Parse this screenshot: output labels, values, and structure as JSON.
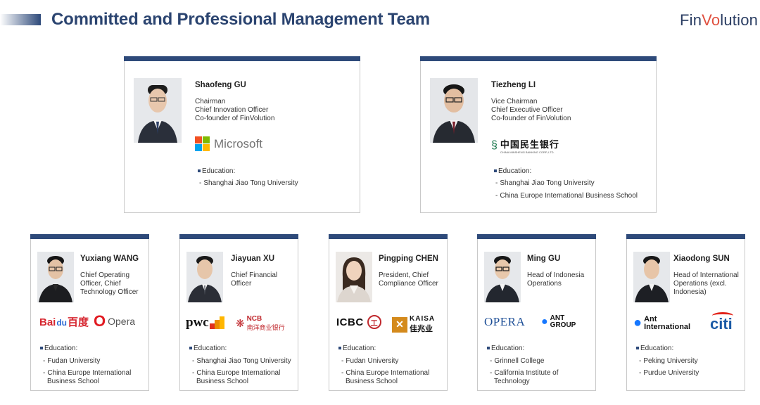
{
  "page": {
    "title": "Committed and Professional Management Team",
    "brand_pre": "Fin",
    "brand_accent": "Vo",
    "brand_post": "lution"
  },
  "colors": {
    "header_blue": "#2e4a7a",
    "title_blue": "#2b4470",
    "brand_red": "#e0503f"
  },
  "edu_label": "Education:",
  "dash": "-",
  "members": [
    {
      "name": "Shaofeng GU",
      "roles": [
        "Chairman",
        "Chief Innovation Officer",
        "Co-founder of FinVolution"
      ],
      "logos": [
        "Microsoft"
      ],
      "education": [
        "Shanghai Jiao Tong University"
      ]
    },
    {
      "name": "Tiezheng LI",
      "roles": [
        "Vice Chairman",
        "Chief Executive Officer",
        "Co-founder of FinVolution"
      ],
      "logos": [
        "中国民生银行",
        "CHINA MINSHENG BANKING CORP.,LTD."
      ],
      "education": [
        "Shanghai Jiao Tong University",
        "China Europe International Business School"
      ]
    },
    {
      "name": "Yuxiang WANG",
      "roles": [
        "Chief Operating",
        "Officer, Chief",
        "Technology Officer"
      ],
      "logos": [
        "Bai",
        "du",
        "百度",
        "Opera"
      ],
      "education": [
        "Fudan University",
        "China Europe International",
        "Business School"
      ]
    },
    {
      "name": "Jiayuan XU",
      "roles": [
        "Chief Financial",
        "Officer"
      ],
      "logos": [
        "pwc",
        "NCB",
        "南洋商业银行"
      ],
      "education": [
        "Shanghai Jiao Tong University",
        "China Europe International",
        "Business School"
      ]
    },
    {
      "name": "Pingping CHEN",
      "roles": [
        "President, Chief",
        "Compliance Officer"
      ],
      "logos": [
        "ICBC",
        "KAISA",
        "佳兆业"
      ],
      "education": [
        "Fudan University",
        "China Europe International",
        "Business School"
      ]
    },
    {
      "name": "Ming GU",
      "roles": [
        "Head of Indonesia",
        "Operations"
      ],
      "logos": [
        "OPERA",
        "ANT",
        "GROUP"
      ],
      "education": [
        "Grinnell College",
        "California Institute of",
        "Technology"
      ]
    },
    {
      "name": "Xiaodong SUN",
      "roles": [
        "Head of International",
        "Operations (excl.",
        "Indonesia)"
      ],
      "logos": [
        "Ant",
        "International",
        "citi"
      ],
      "education": [
        "Peking University",
        "Purdue University"
      ]
    }
  ]
}
